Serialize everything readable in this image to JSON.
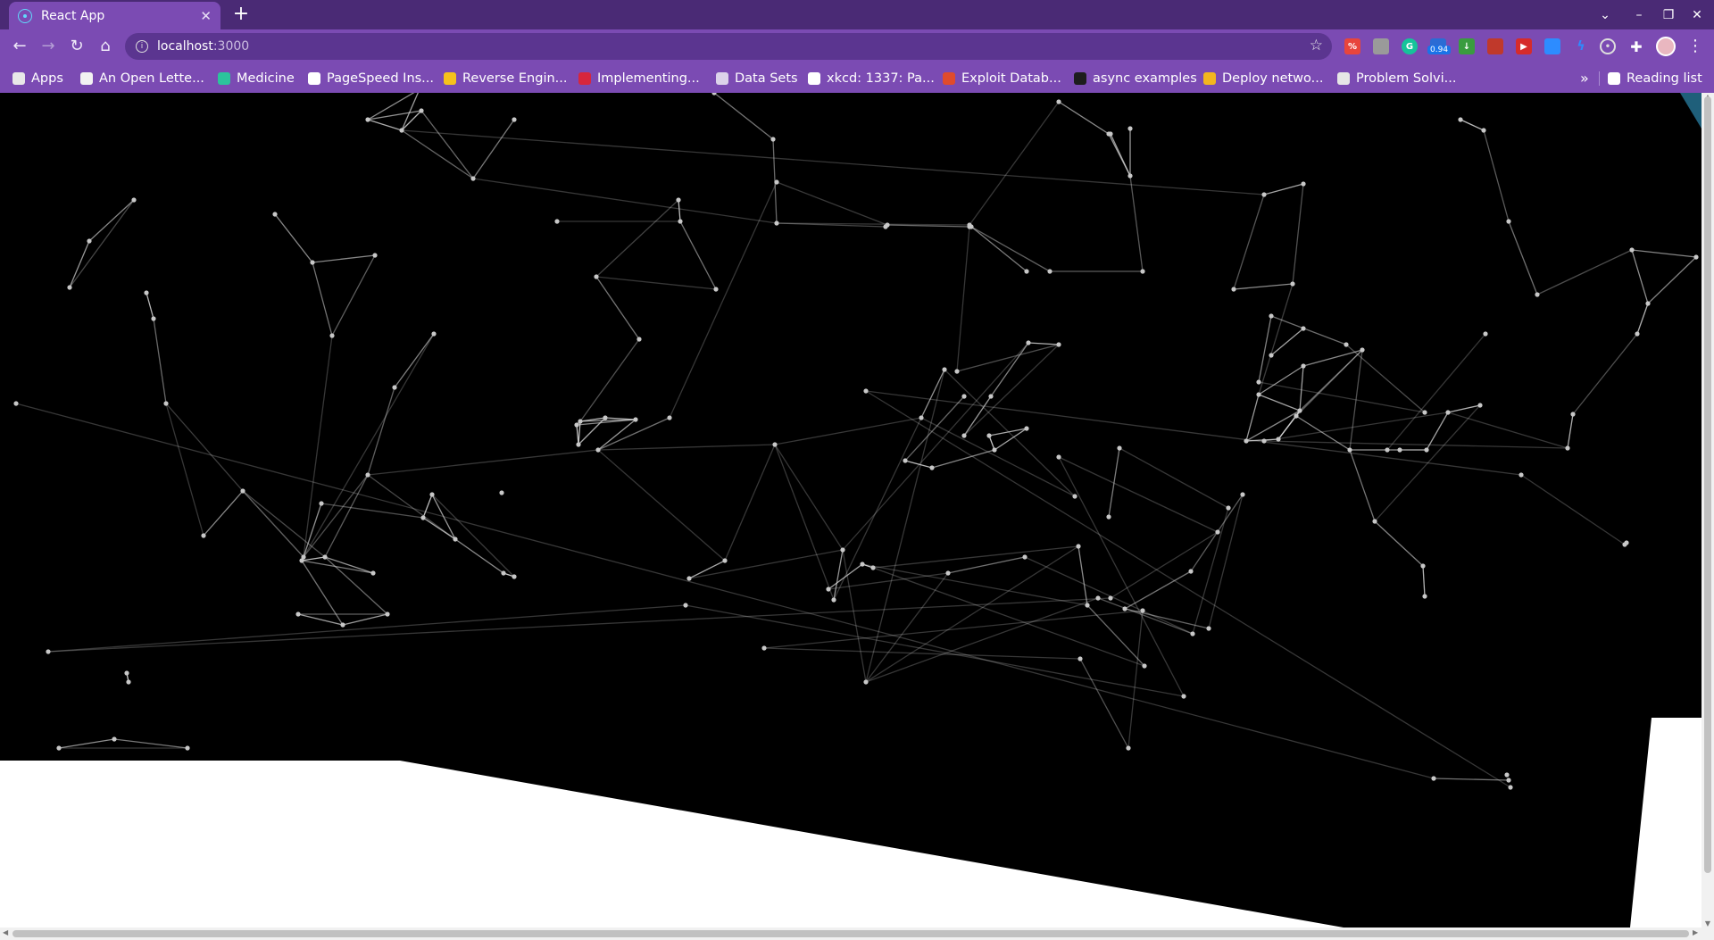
{
  "tab": {
    "title": "React App"
  },
  "address": {
    "host": "localhost",
    "port": ":3000"
  },
  "bookmarks": [
    {
      "label": "Apps",
      "icon": "apps-grid-icon",
      "color": "#e8e8e8"
    },
    {
      "label": "An Open Lette...",
      "icon": "globe-icon",
      "color": "#f2f2f2"
    },
    {
      "label": "Medicine",
      "icon": "medicine-icon",
      "color": "#2cc39c"
    },
    {
      "label": "PageSpeed Ins...",
      "icon": "pagespeed-icon",
      "color": "#ffffff"
    },
    {
      "label": "Reverse Engin...",
      "icon": "reverse-engineering-icon",
      "color": "#f6c21b"
    },
    {
      "label": "Implementing...",
      "icon": "jr-icon",
      "color": "#d7263d"
    },
    {
      "label": "Data Sets",
      "icon": "folder-icon",
      "color": "#dcd3ea"
    },
    {
      "label": "xkcd: 1337: Pa...",
      "icon": "xkcd-icon",
      "color": "#ffffff"
    },
    {
      "label": "Exploit Datab...",
      "icon": "exploit-db-icon",
      "color": "#e04b2c"
    },
    {
      "label": "async examples",
      "icon": "github-icon",
      "color": "#1d1d1d"
    },
    {
      "label": "Deploy netwo...",
      "icon": "cube-icon",
      "color": "#f3b61f"
    },
    {
      "label": "Problem Solvi...",
      "icon": "document-icon",
      "color": "#e6e6e6"
    }
  ],
  "reading_list": "Reading list",
  "extension_badge": "0.94",
  "colors": {
    "tab_strip": "#4a2a75",
    "toolbar": "#7b4bb3",
    "page_accent": "#1f5f7a",
    "canvas": "#000000"
  }
}
